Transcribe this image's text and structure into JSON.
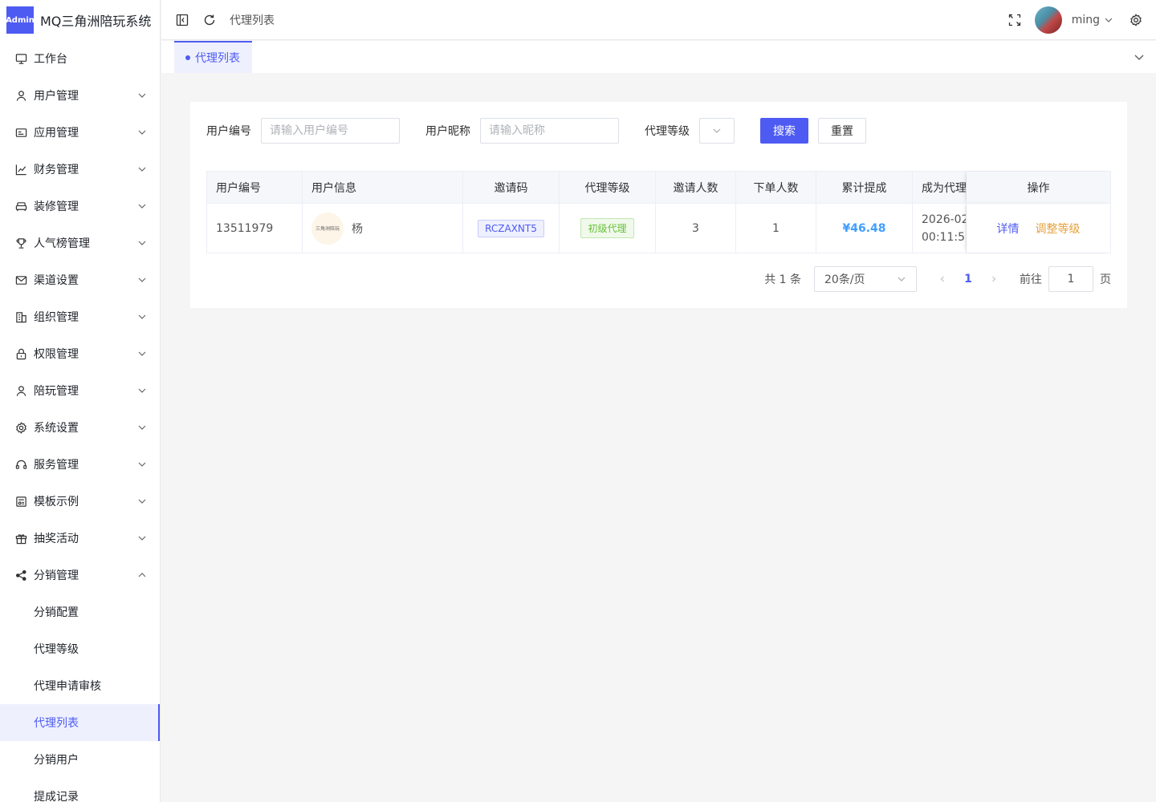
{
  "app": {
    "badge": "Admin",
    "title": "MQ三角洲陪玩系统"
  },
  "sidebar": {
    "items": [
      {
        "label": "工作台",
        "icon": "monitor-icon",
        "has_children": false
      },
      {
        "label": "用户管理",
        "icon": "user-icon",
        "has_children": true
      },
      {
        "label": "应用管理",
        "icon": "app-icon",
        "has_children": true
      },
      {
        "label": "财务管理",
        "icon": "chart-icon",
        "has_children": true
      },
      {
        "label": "装修管理",
        "icon": "sofa-icon",
        "has_children": true
      },
      {
        "label": "人气榜管理",
        "icon": "trophy-icon",
        "has_children": true
      },
      {
        "label": "渠道设置",
        "icon": "mail-icon",
        "has_children": true
      },
      {
        "label": "组织管理",
        "icon": "building-icon",
        "has_children": true
      },
      {
        "label": "权限管理",
        "icon": "lock-icon",
        "has_children": true
      },
      {
        "label": "陪玩管理",
        "icon": "user-icon",
        "has_children": true
      },
      {
        "label": "系统设置",
        "icon": "gear-icon",
        "has_children": true
      },
      {
        "label": "服务管理",
        "icon": "headset-icon",
        "has_children": true
      },
      {
        "label": "模板示例",
        "icon": "template-icon",
        "has_children": true
      },
      {
        "label": "抽奖活动",
        "icon": "gift-icon",
        "has_children": true
      },
      {
        "label": "分销管理",
        "icon": "share-icon",
        "has_children": true,
        "expanded": true
      }
    ],
    "subitems": [
      {
        "label": "分销配置",
        "active": false
      },
      {
        "label": "代理等级",
        "active": false
      },
      {
        "label": "代理申请审核",
        "active": false
      },
      {
        "label": "代理列表",
        "active": true
      },
      {
        "label": "分销用户",
        "active": false
      },
      {
        "label": "提成记录",
        "active": false
      }
    ]
  },
  "header": {
    "breadcrumb": "代理列表",
    "username": "ming"
  },
  "tabs": [
    {
      "label": "代理列表",
      "active": true
    }
  ],
  "search": {
    "user_id_label": "用户编号",
    "user_id_placeholder": "请输入用户编号",
    "nickname_label": "用户昵称",
    "nickname_placeholder": "请输入昵称",
    "level_label": "代理等级",
    "search_button": "搜索",
    "reset_button": "重置"
  },
  "table": {
    "columns": [
      "用户编号",
      "用户信息",
      "邀请码",
      "代理等级",
      "邀请人数",
      "下单人数",
      "累计提成",
      "成为代理",
      "操作"
    ],
    "rows": [
      {
        "user_id": "13511979",
        "avatar_text": "三角洲陪玩",
        "nickname": "杨",
        "invite_code": "RCZAXNT5",
        "level": "初级代理",
        "invite_count": "3",
        "order_count": "1",
        "commission": "¥46.48",
        "date_line1": "2026-02",
        "date_line2": "00:11:59",
        "action_detail": "详情",
        "action_adjust": "调整等级"
      }
    ]
  },
  "pagination": {
    "total": "共 1 条",
    "page_size": "20条/页",
    "current": "1",
    "goto_label": "前往",
    "goto_value": "1",
    "page_suffix": "页"
  },
  "colors": {
    "primary": "#4e5bf2",
    "success": "#67c23a",
    "warning": "#e6a23c",
    "money": "#409eff"
  }
}
